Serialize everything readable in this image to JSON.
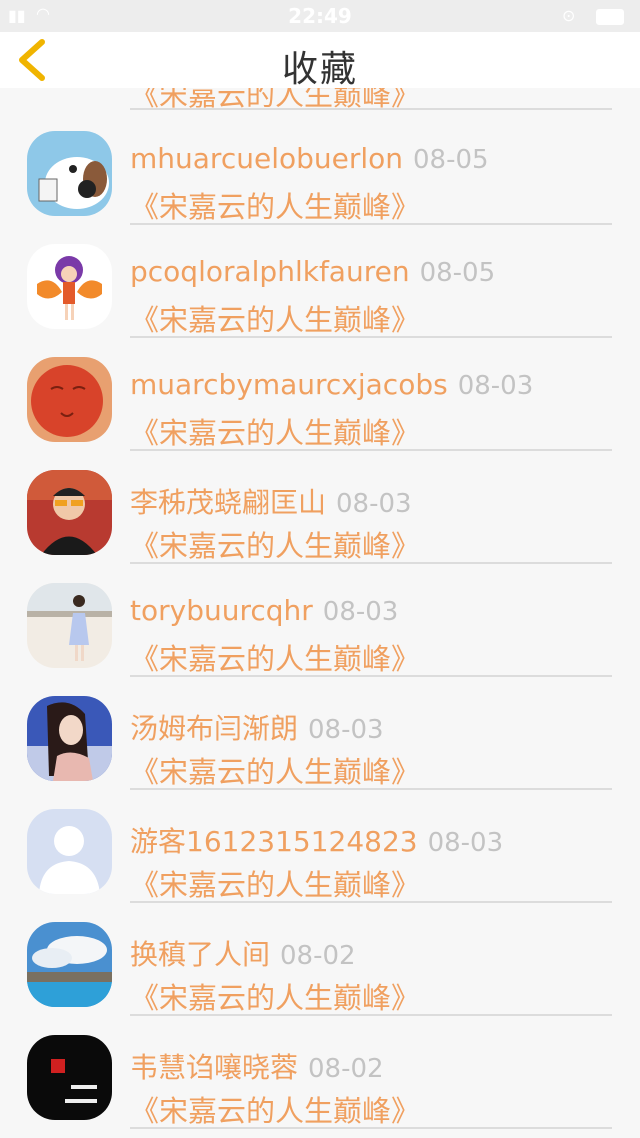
{
  "status_bar": {
    "time": "22:49"
  },
  "nav": {
    "title": "收藏",
    "back_icon": "chevron-left-icon",
    "accent": "#f0b400"
  },
  "partial_item": {
    "book": "《宋嘉云的人生巅峰》"
  },
  "items": [
    {
      "user": "mhuarcuelobuerlon",
      "date": "08-05",
      "book": "《宋嘉云的人生巅峰》"
    },
    {
      "user": "pcoqloralphlkfauren",
      "date": "08-05",
      "book": "《宋嘉云的人生巅峰》"
    },
    {
      "user": "muarcbymaurcxjacobs",
      "date": "08-03",
      "book": "《宋嘉云的人生巅峰》"
    },
    {
      "user": "李秭茂蛲翩匡山",
      "date": "08-03",
      "book": "《宋嘉云的人生巅峰》"
    },
    {
      "user": "torybuurcqhr",
      "date": "08-03",
      "book": "《宋嘉云的人生巅峰》"
    },
    {
      "user": "汤姆布闫渐朗",
      "date": "08-03",
      "book": "《宋嘉云的人生巅峰》"
    },
    {
      "user": "游客1612315124823",
      "date": "08-03",
      "book": "《宋嘉云的人生巅峰》"
    },
    {
      "user": "换稹了人间",
      "date": "08-02",
      "book": "《宋嘉云的人生巅峰》"
    },
    {
      "user": "韦慧诌嚷晓蓉",
      "date": "08-02",
      "book": "《宋嘉云的人生巅峰》"
    }
  ],
  "colors": {
    "user_text": "#f0a060",
    "date_text": "#c3c3c3",
    "background": "#f7f7f7"
  }
}
